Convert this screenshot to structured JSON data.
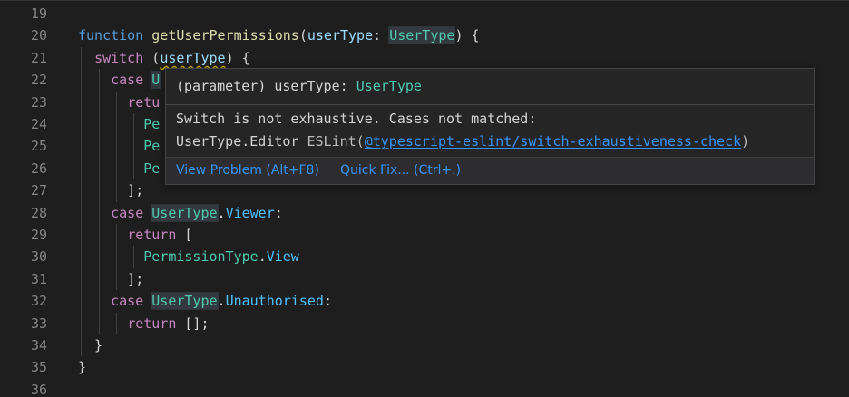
{
  "editor": {
    "lines": [
      {
        "no": "19",
        "tokens": []
      },
      {
        "no": "20",
        "tokens": [
          {
            "t": "function",
            "c": "kw"
          },
          {
            "t": " ",
            "c": "punc"
          },
          {
            "t": "getUserPermissions",
            "c": "fn"
          },
          {
            "t": "(",
            "c": "punc"
          },
          {
            "t": "userType",
            "c": "param"
          },
          {
            "t": ": ",
            "c": "punc"
          },
          {
            "t": "UserType",
            "c": "type hl"
          },
          {
            "t": ") {",
            "c": "punc"
          }
        ]
      },
      {
        "no": "21",
        "tokens": [
          {
            "t": "  ",
            "c": "punc"
          },
          {
            "t": "switch",
            "c": "ctl"
          },
          {
            "t": " (",
            "c": "punc"
          },
          {
            "t": "userType",
            "c": "param squiggle"
          },
          {
            "t": ") {",
            "c": "punc"
          }
        ]
      },
      {
        "no": "22",
        "tokens": [
          {
            "t": "    ",
            "c": "punc"
          },
          {
            "t": "case",
            "c": "ctl"
          },
          {
            "t": " ",
            "c": "punc"
          },
          {
            "t": "U",
            "c": "type hl"
          }
        ]
      },
      {
        "no": "23",
        "tokens": [
          {
            "t": "      ",
            "c": "punc"
          },
          {
            "t": "retu",
            "c": "ctl"
          }
        ]
      },
      {
        "no": "24",
        "tokens": [
          {
            "t": "        ",
            "c": "punc"
          },
          {
            "t": "Pe",
            "c": "type"
          }
        ]
      },
      {
        "no": "25",
        "tokens": [
          {
            "t": "        ",
            "c": "punc"
          },
          {
            "t": "Pe",
            "c": "type"
          }
        ]
      },
      {
        "no": "26",
        "tokens": [
          {
            "t": "        ",
            "c": "punc"
          },
          {
            "t": "Pe",
            "c": "type"
          }
        ]
      },
      {
        "no": "27",
        "tokens": [
          {
            "t": "      ];",
            "c": "punc"
          }
        ]
      },
      {
        "no": "28",
        "tokens": [
          {
            "t": "    ",
            "c": "punc"
          },
          {
            "t": "case",
            "c": "ctl"
          },
          {
            "t": " ",
            "c": "punc"
          },
          {
            "t": "UserType",
            "c": "type hl"
          },
          {
            "t": ".",
            "c": "punc"
          },
          {
            "t": "Viewer",
            "c": "prop"
          },
          {
            "t": ":",
            "c": "punc"
          }
        ]
      },
      {
        "no": "29",
        "tokens": [
          {
            "t": "      ",
            "c": "punc"
          },
          {
            "t": "return",
            "c": "ctl"
          },
          {
            "t": " [",
            "c": "punc"
          }
        ]
      },
      {
        "no": "30",
        "tokens": [
          {
            "t": "        ",
            "c": "punc"
          },
          {
            "t": "PermissionType",
            "c": "type"
          },
          {
            "t": ".",
            "c": "punc"
          },
          {
            "t": "View",
            "c": "prop"
          }
        ]
      },
      {
        "no": "31",
        "tokens": [
          {
            "t": "      ];",
            "c": "punc"
          }
        ]
      },
      {
        "no": "32",
        "tokens": [
          {
            "t": "    ",
            "c": "punc"
          },
          {
            "t": "case",
            "c": "ctl"
          },
          {
            "t": " ",
            "c": "punc"
          },
          {
            "t": "UserType",
            "c": "type hl"
          },
          {
            "t": ".",
            "c": "punc"
          },
          {
            "t": "Unauthorised",
            "c": "prop"
          },
          {
            "t": ":",
            "c": "punc"
          }
        ]
      },
      {
        "no": "33",
        "tokens": [
          {
            "t": "      ",
            "c": "punc"
          },
          {
            "t": "return",
            "c": "ctl"
          },
          {
            "t": " [];",
            "c": "punc"
          }
        ]
      },
      {
        "no": "34",
        "tokens": [
          {
            "t": "  }",
            "c": "punc"
          }
        ]
      },
      {
        "no": "35",
        "tokens": [
          {
            "t": "}",
            "c": "punc"
          }
        ]
      },
      {
        "no": "36",
        "tokens": []
      }
    ]
  },
  "hover": {
    "sig_prefix": "(parameter) userType: ",
    "sig_type": "UserType",
    "message_line1": "Switch is not exhaustive. Cases not matched:",
    "message_line2_prefix": "UserType.Editor ",
    "source": "ESLint(",
    "rule": "@typescript-eslint/switch-exhaustiveness-check",
    "source_close": ")",
    "action_view_problem": "View Problem (Alt+F8)",
    "action_quick_fix": "Quick Fix... (Ctrl+.)"
  },
  "colors": {
    "background": "#1e1e1e",
    "keyword": "#569cd6",
    "control": "#c586c0",
    "function": "#dcdcaa",
    "parameter": "#9cdcfe",
    "type": "#4ec9b0",
    "property": "#4fc1ff",
    "link": "#3794ff",
    "warning_squiggle": "#cca700"
  }
}
